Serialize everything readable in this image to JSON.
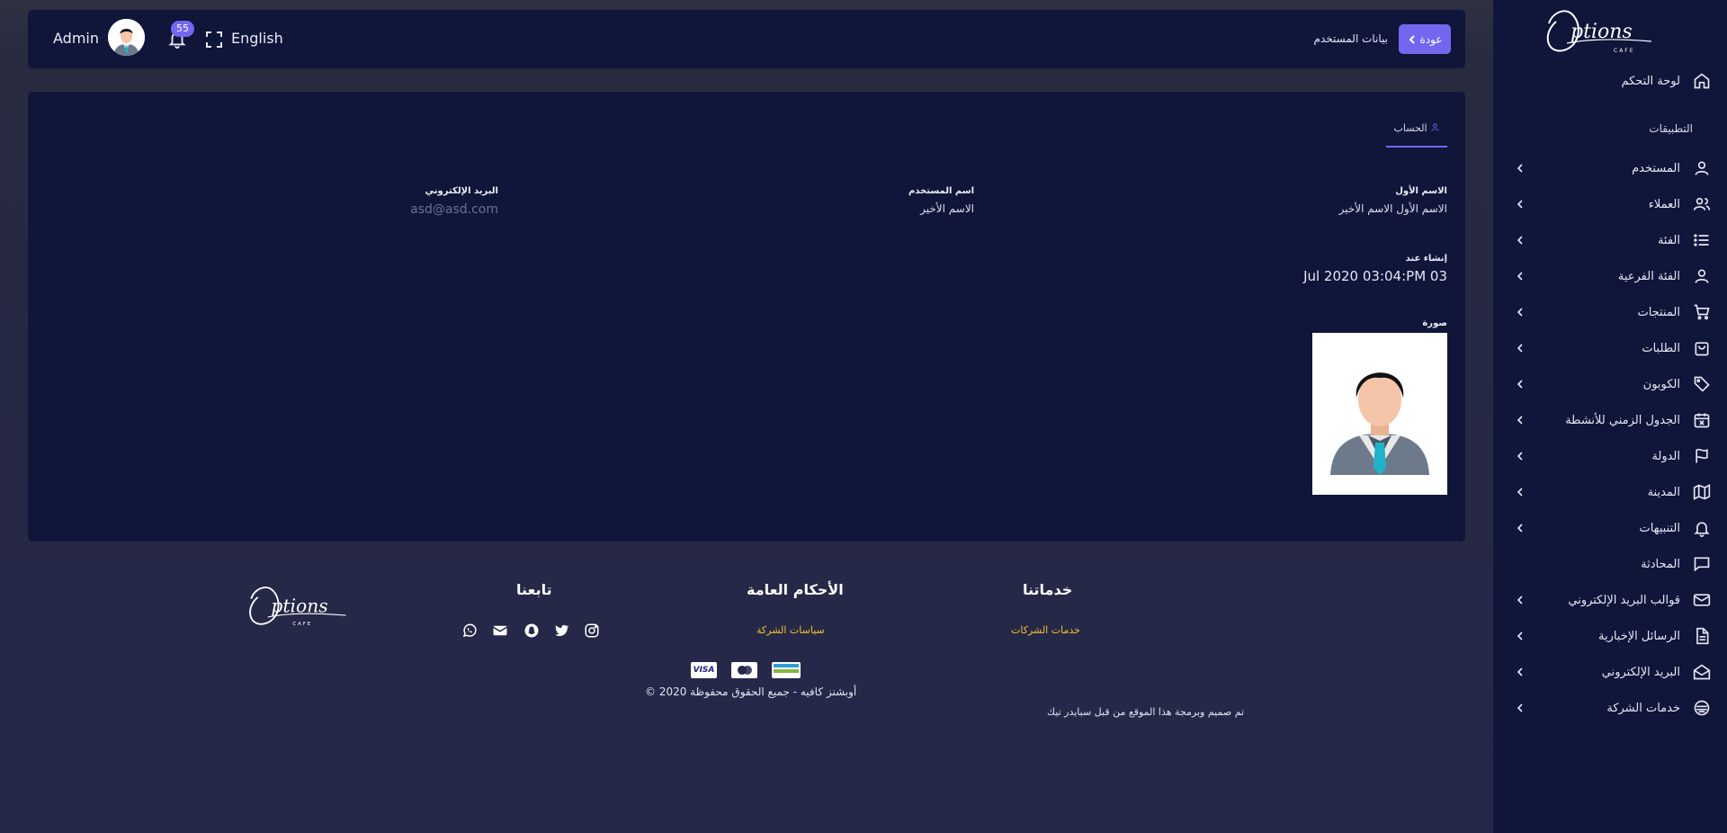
{
  "app": {
    "logo_text": "Options",
    "logo_sub": "CAFE"
  },
  "header": {
    "back_label": "عودة",
    "page_title": "بيانات المستخدم",
    "admin_name": "Admin",
    "notification_count": "55",
    "language": "English"
  },
  "sidebar": {
    "dashboard": "لوحة التحكم",
    "section_title": "التطبيقات",
    "items": [
      {
        "label": "المستخدم",
        "icon": "user-icon"
      },
      {
        "label": "العملاء",
        "icon": "users-icon"
      },
      {
        "label": "الفئة",
        "icon": "list-icon"
      },
      {
        "label": "الفئة الفرعية",
        "icon": "user-icon"
      },
      {
        "label": "المنتجات",
        "icon": "cart-icon"
      },
      {
        "label": "الطلبات",
        "icon": "shopping-bag-icon"
      },
      {
        "label": "الكوبون",
        "icon": "tag-icon"
      },
      {
        "label": "الجدول الزمني للأنشطة",
        "icon": "calendar-x-icon"
      },
      {
        "label": "الدولة",
        "icon": "flag-icon"
      },
      {
        "label": "المدينة",
        "icon": "map-icon"
      },
      {
        "label": "التنبيهات",
        "icon": "bell-icon"
      },
      {
        "label": "المحادثة",
        "icon": "message-icon"
      },
      {
        "label": "قوالب البريد الإلكتروني",
        "icon": "mail-icon"
      },
      {
        "label": "الرسائل الإخبارية",
        "icon": "file-text-icon"
      },
      {
        "label": "البريد الإلكتروني",
        "icon": "mail-open-icon"
      },
      {
        "label": "خدمات الشركة",
        "icon": "service-icon"
      }
    ]
  },
  "profile": {
    "tab_label": "الحساب",
    "first_name_label": "الاسم الأول",
    "first_name_value": "الاسم الأول الاسم الأخير",
    "username_label": "اسم المستخدم",
    "username_value": "الاسم الأخير",
    "email_label": "البريد الإلكتروني",
    "email_value": "asd@asd.com",
    "created_label": "إنشاء عند",
    "created_value": "Jul 2020 03:04:PM 03",
    "photo_label": "صورة"
  },
  "footer": {
    "services_heading": "خدماتنا",
    "services_link": "خدمات الشركات",
    "terms_heading": "الأحكام العامة",
    "terms_link": "سياسات الشركة",
    "follow_heading": "تابعنا",
    "social_icons": [
      "instagram-icon",
      "twitter-icon",
      "snapchat-icon",
      "email-icon",
      "whatsapp-icon"
    ],
    "payment_methods": [
      "mada",
      "mastercard",
      "VISA"
    ],
    "copyright": "© 2020 أوبشنز كافيه - جميع الحقوق محفوظة",
    "credit": "تم صميم وبرمجة هذا الموقع من قبل سبايدر تيك"
  },
  "colors": {
    "accent": "#7367f0",
    "sidebar_bg": "#10153a",
    "card_bg": "#10153a",
    "link_yellow": "#f2c230"
  }
}
